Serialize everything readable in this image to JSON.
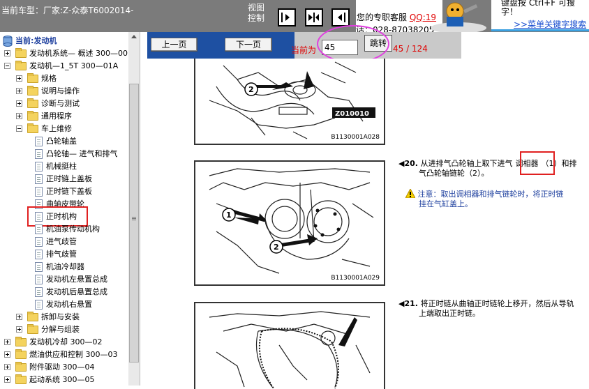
{
  "header": {
    "car_type": "当前车型：厂家:Z-众泰T6002014-",
    "view_control": [
      "视图",
      "控制"
    ],
    "nav_icons": [
      "collapse-left-icon",
      "split-view-icon",
      "expand-right-icon"
    ],
    "service_text": "您的专职客服",
    "service_qq": "QQ:19",
    "service_phone": "话：028-87038205",
    "hint_text_line1": "键盘按 Ctrl+F 可搜",
    "hint_text_line2": "字！",
    "hint_link": ">>菜单关键字搜索"
  },
  "sidebar": {
    "root": "当前:发动机",
    "items": [
      {
        "label": "发动机系统— 概述 300—00",
        "type": "folder",
        "level": 0,
        "expanded": false
      },
      {
        "label": "发动机—1_5T 300—01A",
        "type": "folder",
        "level": 0,
        "expanded": true
      },
      {
        "label": "规格",
        "type": "folder",
        "level": 1,
        "expanded": false
      },
      {
        "label": "说明与操作",
        "type": "folder",
        "level": 1,
        "expanded": false
      },
      {
        "label": "诊断与测试",
        "type": "folder",
        "level": 1,
        "expanded": false
      },
      {
        "label": "通用程序",
        "type": "folder",
        "level": 1,
        "expanded": false
      },
      {
        "label": "车上维修",
        "type": "folder",
        "level": 1,
        "expanded": true
      },
      {
        "label": "凸轮轴盖",
        "type": "doc",
        "level": 2
      },
      {
        "label": "凸轮轴— 进气和排气",
        "type": "doc",
        "level": 2
      },
      {
        "label": "机械挺柱",
        "type": "doc",
        "level": 2
      },
      {
        "label": "正时链上盖板",
        "type": "doc",
        "level": 2
      },
      {
        "label": "正时链下盖板",
        "type": "doc",
        "level": 2
      },
      {
        "label": "曲轴皮带轮",
        "type": "doc",
        "level": 2
      },
      {
        "label": "正时机构",
        "type": "doc",
        "level": 2,
        "selected": true
      },
      {
        "label": "机油泵传动机构",
        "type": "doc",
        "level": 2
      },
      {
        "label": "进气歧管",
        "type": "doc",
        "level": 2
      },
      {
        "label": "排气歧管",
        "type": "doc",
        "level": 2
      },
      {
        "label": "机油冷却器",
        "type": "doc",
        "level": 2
      },
      {
        "label": "发动机左悬置总成",
        "type": "doc",
        "level": 2
      },
      {
        "label": "发动机后悬置总成",
        "type": "doc",
        "level": 2
      },
      {
        "label": "发动机右悬置",
        "type": "doc",
        "level": 2
      },
      {
        "label": "拆卸与安装",
        "type": "folder",
        "level": 1,
        "expanded": false
      },
      {
        "label": "分解与组装",
        "type": "folder",
        "level": 1,
        "expanded": false
      },
      {
        "label": "发动机冷却 300—02",
        "type": "folder",
        "level": 0,
        "expanded": false
      },
      {
        "label": "燃油供应和控制 300—03",
        "type": "folder",
        "level": 0,
        "expanded": false
      },
      {
        "label": "附件驱动 300—04",
        "type": "folder",
        "level": 0,
        "expanded": false
      },
      {
        "label": "起动系统 300—05",
        "type": "folder",
        "level": 0,
        "expanded": false
      }
    ]
  },
  "pager": {
    "prev_label": "上一页",
    "next_label": "下一页",
    "current_label": "当前为",
    "current_value": "45",
    "go_label": "跳转",
    "page_count": "45 / 124"
  },
  "document": {
    "fig1": {
      "code": "B1130001A028",
      "badge": "Z010010",
      "callout": "2"
    },
    "fig2": {
      "code": "B1130001A029",
      "callouts": [
        "1",
        "2"
      ]
    },
    "step20": {
      "number": "◀20.",
      "text_before": "从进排气凸轮轴上取下进",
      "text_tail": "气",
      "highlight": "调相器",
      "text_after": "（1）和排",
      "line2": "气凸轮轴链轮（2）。"
    },
    "warning": {
      "label": "注意：",
      "line1": "取出调相器和排气链轮时，将正时链",
      "line2": "挂在气缸盖上。"
    },
    "step21": {
      "number": "◀21.",
      "line1": "将正时链从曲轴正时链轮上移开，然后从导轨",
      "line2": "上端取出正时链。"
    }
  }
}
